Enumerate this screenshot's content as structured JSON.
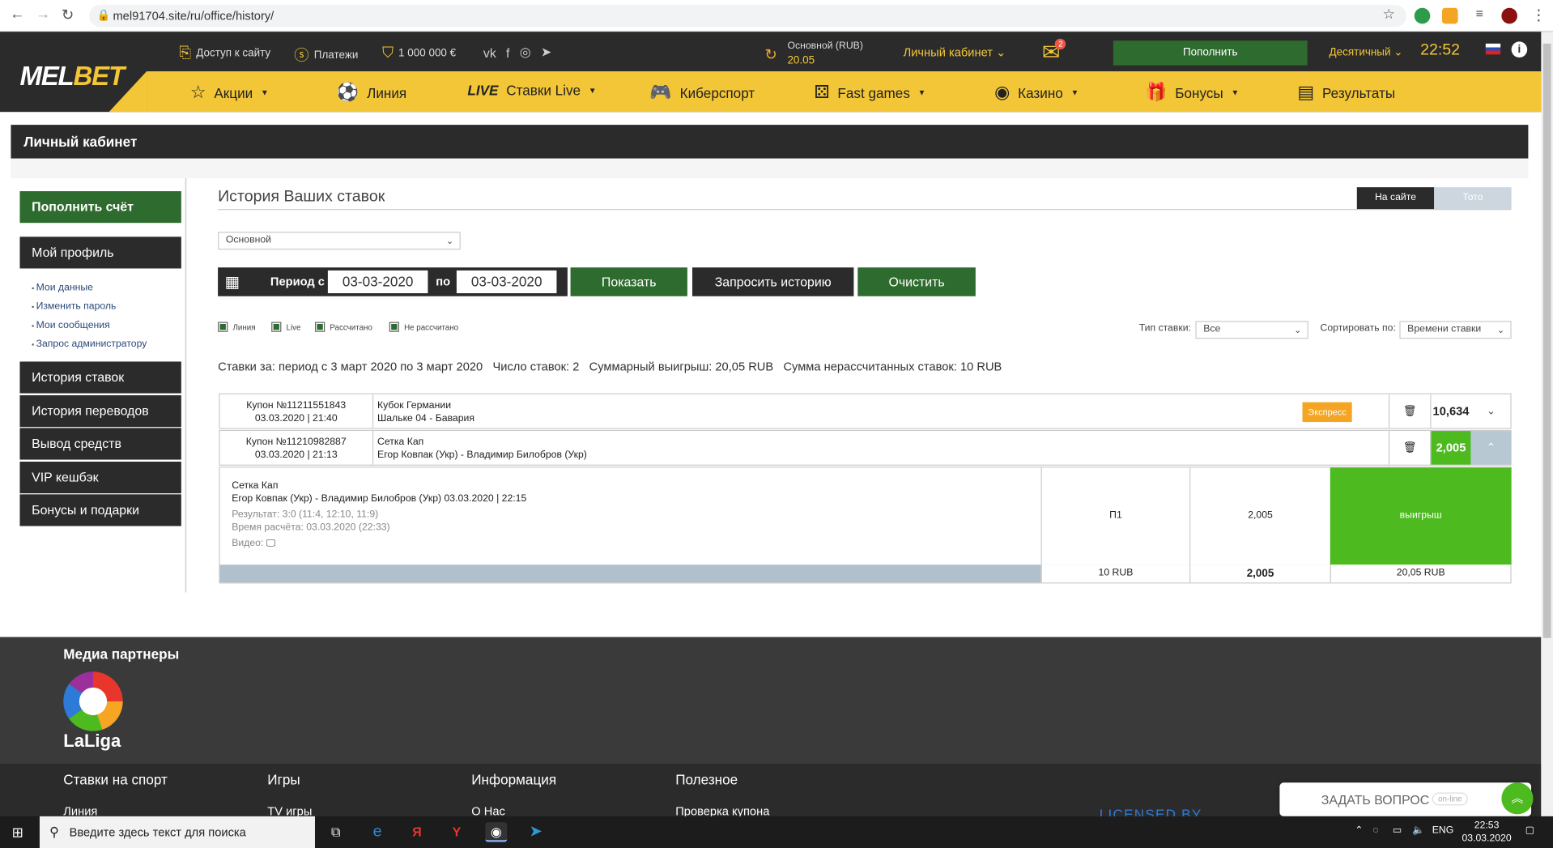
{
  "browser": {
    "url": "mel91704.site/ru/office/history/"
  },
  "header": {
    "logo_part1": "MEL",
    "logo_part2": "BET",
    "site_access": "Доступ к сайту",
    "payments": "Платежи",
    "jackpot": "1 000 000 €",
    "balance_label": "Основной (RUB)",
    "balance_value": "20.05",
    "cabinet": "Личный кабинет",
    "mail_count": "2",
    "deposit": "Пополнить",
    "odds_format": "Десятичный",
    "time": "22:52"
  },
  "menu": [
    {
      "label": "Акции",
      "icon": "star-icon"
    },
    {
      "label": "Линия",
      "icon": "football-icon"
    },
    {
      "label": "Ставки Live",
      "prefix": "LIVE"
    },
    {
      "label": "Киберспорт",
      "icon": "gamepad-icon"
    },
    {
      "label": "Fast games",
      "icon": "dice-icon"
    },
    {
      "label": "Казино",
      "icon": "casino-icon"
    },
    {
      "label": "Бонусы",
      "icon": "gift-icon"
    },
    {
      "label": "Результаты",
      "icon": "results-icon"
    }
  ],
  "page": {
    "cabinet_title": "Личный кабинет",
    "title": "История Ваших ставок",
    "tab_site": "На сайте",
    "tab_toto": "Тото",
    "account_select": "Основной",
    "period_from": "Период с",
    "period_to": "по",
    "date_from": "03-03-2020",
    "date_to": "03-03-2020",
    "btn_show": "Показать",
    "btn_request": "Запросить историю",
    "btn_clear": "Очистить",
    "filters": [
      "Линия",
      "Live",
      "Рассчитано",
      "Не рассчитано"
    ],
    "bet_type_label": "Тип ставки:",
    "bet_type_value": "Все",
    "sort_label": "Сортировать по:",
    "sort_value": "Времени ставки",
    "summary_period": "Ставки за: период с 3 март 2020 по 3 март 2020",
    "summary_count": "Число ставок: 2",
    "summary_win": "Суммарный выигрыш: 20,05 RUB",
    "summary_unsettled": "Сумма нерассчитанных ставок: 10 RUB"
  },
  "sidebar": {
    "deposit": "Пополнить счёт",
    "profile": "Мой профиль",
    "sublinks": [
      "Мои данные",
      "Изменить пароль",
      "Мои сообщения",
      "Запрос администратору"
    ],
    "items": [
      "История ставок",
      "История переводов",
      "Вывод средств",
      "VIP кешбэк",
      "Бонусы и подарки"
    ]
  },
  "bets": [
    {
      "coupon": "Купон №11211551843",
      "datetime": "03.03.2020 | 21:40",
      "tournament": "Кубок Германии",
      "match": "Шальке 04 - Бавария",
      "badge": "Экспресс",
      "coef": "10,634"
    },
    {
      "coupon": "Купон №11210982887",
      "datetime": "03.03.2020 | 21:13",
      "tournament": "Сетка Кап",
      "match": "Егор Ковпак (Укр) - Владимир Билобров (Укр)",
      "coef": "2,005"
    }
  ],
  "detail": {
    "tournament": "Сетка Кап",
    "match": "Егор Ковпак (Укр) - Владимир Билобров (Укр) 03.03.2020 | 22:15",
    "result": "Результат: 3:0 (11:4, 12:10, 11:9)",
    "calc_time": "Время расчёта: 03.03.2020 (22:33)",
    "video": "Видео:",
    "outcome": "П1",
    "coef": "2,005",
    "status": "выигрыш",
    "stake": "10 RUB",
    "total_coef": "2,005",
    "payout": "20,05 RUB"
  },
  "footer": {
    "media_partners": "Медиа партнеры",
    "laliga": "LaLiga",
    "col1": "Ставки на спорт",
    "col2": "Игры",
    "col3": "Информация",
    "col4": "Полезное",
    "sub1": "Линия",
    "sub2": "TV игры",
    "sub3": "О Нас",
    "sub4": "Проверка купона",
    "licensed": "LICENSED BY",
    "ask": "ЗАДАТЬ ВОПРОС",
    "online": "on-line"
  },
  "taskbar": {
    "search_placeholder": "Введите здесь текст для поиска",
    "lang": "ENG",
    "time": "22:53",
    "date": "03.03.2020"
  },
  "colors": {
    "accent": "#f3c637",
    "dark": "#2b2b2b",
    "green": "#2e6b2e",
    "win": "#4dbb1f",
    "express": "#f3a523"
  }
}
